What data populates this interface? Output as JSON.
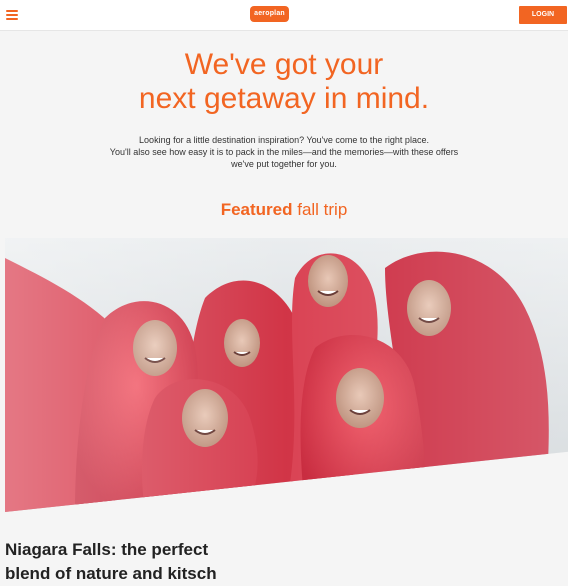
{
  "header": {
    "menu_icon": "hamburger-icon",
    "logo_text": "aeroplan",
    "login_label": "LOGIN",
    "accent_color": "#f26522"
  },
  "hero": {
    "title_line1": "We've got your",
    "title_line2": "next getaway in mind.",
    "intro_line1": "Looking for a little destination inspiration? You've come to the right place.",
    "intro_line2": "You'll also see how easy it is to pack in the miles—and the memories—with these offers",
    "intro_line3": "we've put together for you."
  },
  "featured": {
    "bold": "Featured",
    "rest": " fall trip"
  },
  "article": {
    "title_line1": "Niagara Falls: the perfect",
    "title_line2": "blend of nature and kitsch"
  }
}
